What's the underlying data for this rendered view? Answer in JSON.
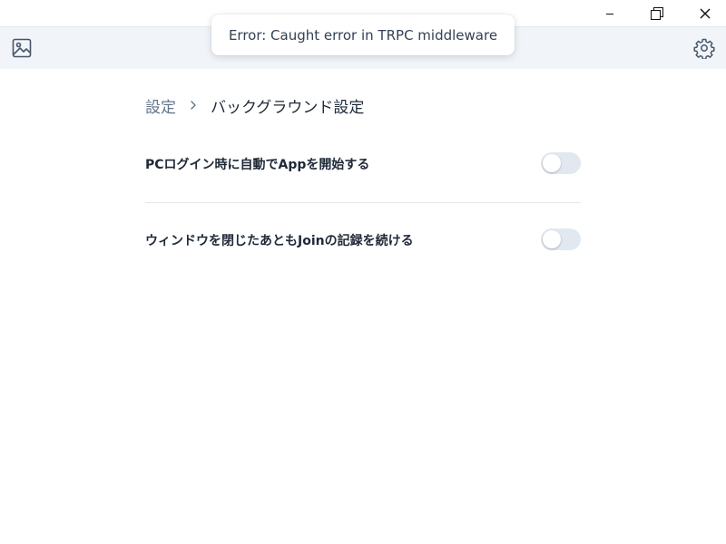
{
  "toast": {
    "message": "Error: Caught error in TRPC middleware"
  },
  "window_controls": {
    "icons": [
      "minimize-icon",
      "maximize-icon",
      "close-icon"
    ]
  },
  "appbar": {
    "left_icon": "image-icon",
    "right_icon": "gear-icon"
  },
  "breadcrumb": {
    "parent": "設定",
    "separator_icon": "chevron-right-icon",
    "current": "バックグラウンド設定"
  },
  "settings": [
    {
      "label": "PCログイン時に自動でAppを開始する",
      "enabled": false
    },
    {
      "label": "ウィンドウを閉じたあともJoinの記録を続ける",
      "enabled": false
    }
  ],
  "colors": {
    "appbar_bg": "#f1f5f9",
    "toggle_off": "#e2e8f0",
    "text_primary": "#1f2937",
    "text_muted": "#64748b"
  }
}
